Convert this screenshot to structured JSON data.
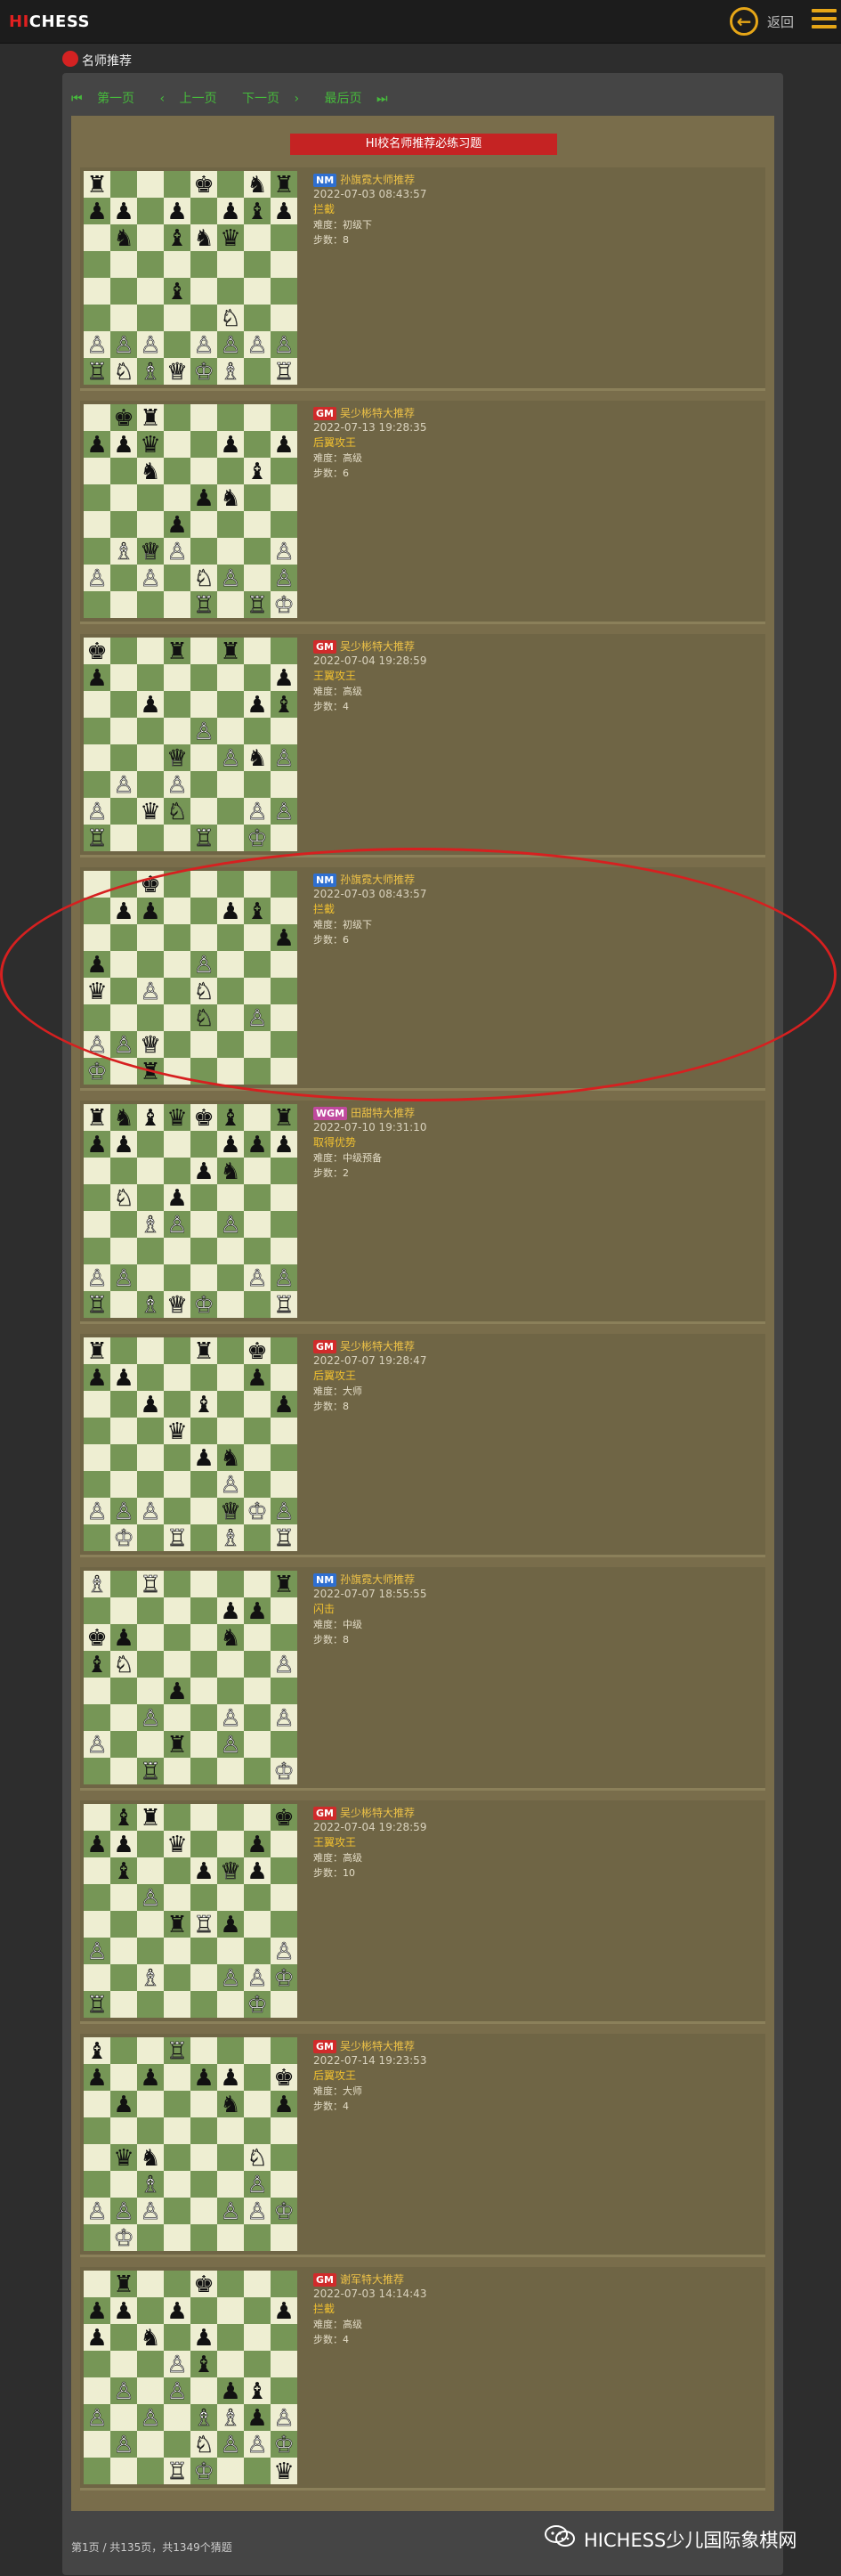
{
  "header": {
    "logo_hi": "HI",
    "logo_chess": "CHESS",
    "back_label": "返回",
    "colors": {
      "accent": "#e6a617",
      "brand_red": "#e02020"
    }
  },
  "section": {
    "title": "名师推荐"
  },
  "pagination": {
    "first": "第一页",
    "prev": "上一页",
    "next": "下一页",
    "last": "最后页"
  },
  "panel_title": "HI校名师推荐必练习题",
  "puzzles": [
    {
      "badge": "NM",
      "coach": "孙旗霓大师推荐",
      "time": "2022-07-03 08:43:57",
      "theme": "拦截",
      "difficulty": "难度：初级下",
      "steps": "步数：8",
      "fen": "r3k1nr/pp1p1pbp/1n1bnq2/8/3b4/5N2/PPP1PPPP/RNBQKB1R"
    },
    {
      "badge": "GM",
      "coach": "吴少彬特大推荐",
      "time": "2022-07-13 19:28:35",
      "theme": "后翼攻王",
      "difficulty": "难度：高级",
      "steps": "步数：6",
      "fen": "1kr5/ppq2p1p/2n3b1/4pn2/3p4/1BQP3P/P1P1NP1P/4R1RK"
    },
    {
      "badge": "GM",
      "coach": "吴少彬特大推荐",
      "time": "2022-07-04 19:28:59",
      "theme": "王翼攻王",
      "difficulty": "难度：高级",
      "steps": "步数：4",
      "fen": "k2r1r2/p6p/2p3pb/4P3/3Q1PnP/1P1P4/P1qN2PP/R3R1K1"
    },
    {
      "badge": "NM",
      "coach": "孙旗霓大师推荐",
      "time": "2022-07-03 08:43:57",
      "theme": "拦截",
      "difficulty": "难度：初级下",
      "steps": "步数：6",
      "fen": "2k5/1pp2pb1/7p/p3P3/q1P1N3/4N1P1/PPQ5/K1r5"
    },
    {
      "badge": "WGM",
      "coach": "田甜特大推荐",
      "time": "2022-07-10 19:31:10",
      "theme": "取得优势",
      "difficulty": "难度：中级预备",
      "steps": "步数：2",
      "fen": "rnbqkb1r/pp3ppp/4pn2/1N1p4/2BP1P2/8/PP4PP/R1BQK2R"
    },
    {
      "badge": "GM",
      "coach": "吴少彬特大推荐",
      "time": "2022-07-07 19:28:47",
      "theme": "后翼攻王",
      "difficulty": "难度：大师",
      "steps": "步数：8",
      "fen": "r3r1k1/pp4p1/2p1b2p/3q4/4pn2/5P2/PPP2QKP/1K1R1B1R"
    },
    {
      "badge": "NM",
      "coach": "孙旗霓大师推荐",
      "time": "2022-07-07 18:55:55",
      "theme": "闪击",
      "difficulty": "难度：中级",
      "steps": "步数：8",
      "fen": "B1R4r/5pp1/kp3n2/bN5P/3p4/2P2P1P/P2r1P2/2R4K"
    },
    {
      "badge": "GM",
      "coach": "吴少彬特大推荐",
      "time": "2022-07-04 19:28:59",
      "theme": "王翼攻王",
      "difficulty": "难度：高级",
      "steps": "步数：10",
      "fen": "1br4k/pp1q2p1/1b2pQp1/2P5/3rRp2/P6P/2B2PPK/R5K1"
    },
    {
      "badge": "GM",
      "coach": "吴少彬特大推荐",
      "time": "2022-07-14 19:23:53",
      "theme": "后翼攻王",
      "difficulty": "难度：大师",
      "steps": "步数：4",
      "fen": "b2R4/p1p1pp1k/1p3n1p/8/1qn3N1/2B3P1/PPP2PPK/1K6"
    },
    {
      "badge": "GM",
      "coach": "谢军特大推荐",
      "time": "2022-07-03 14:14:43",
      "theme": "拦截",
      "difficulty": "难度：高级",
      "steps": "步数：4",
      "fen": "1r2k3/pp1p3p/p1n1p3/3Pb3/1P1P1pb1/P1P1BBpP/1P2NPPK/3RK2q"
    }
  ],
  "footer": {
    "text": "第1页 / 共135页，共1349个猜题"
  },
  "watermark": {
    "text": "HICHESS少儿国际象棋网"
  }
}
